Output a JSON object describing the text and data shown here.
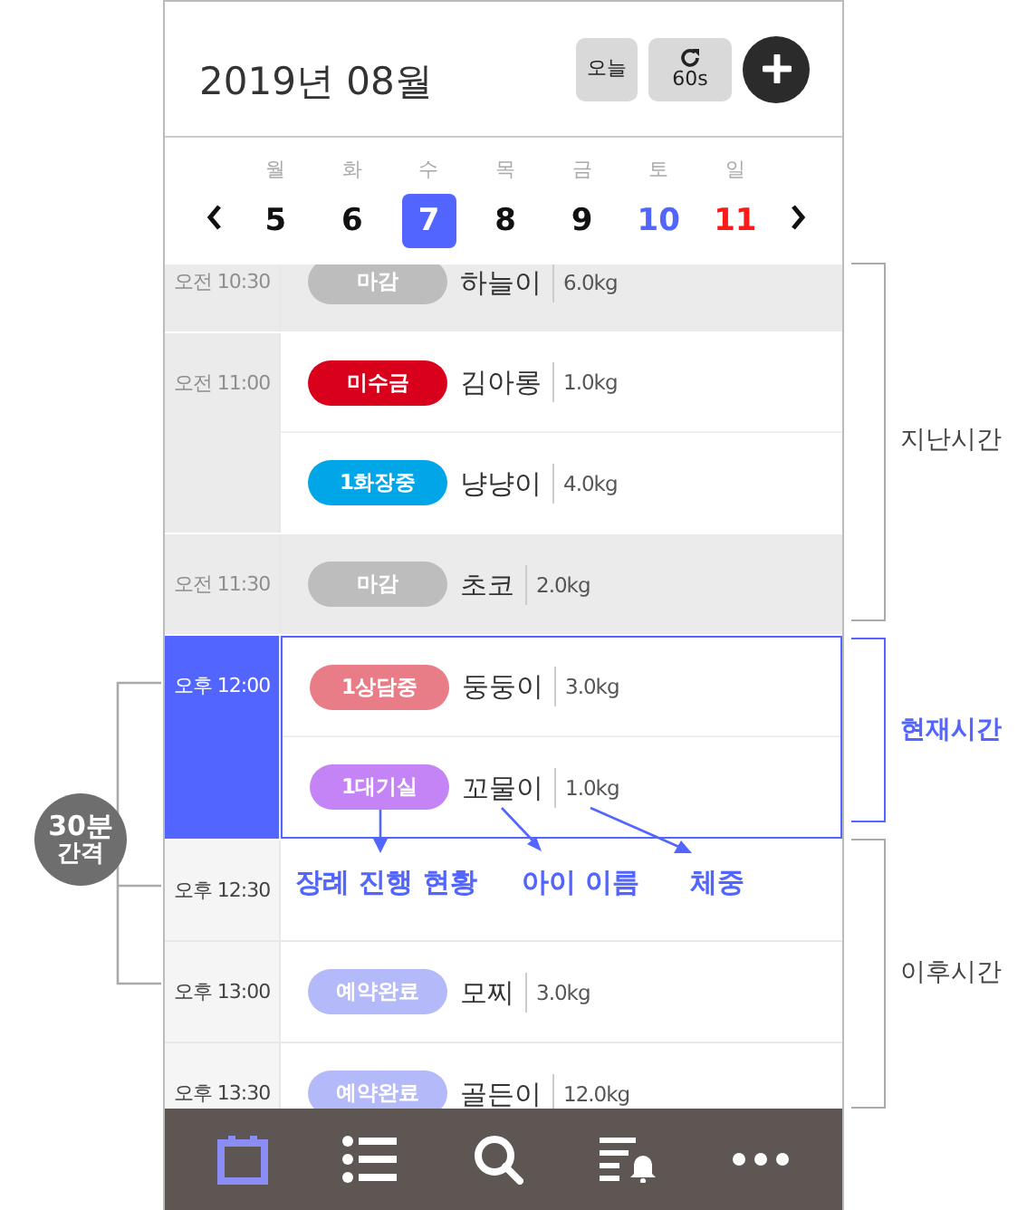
{
  "header": {
    "title": "2019년 08월",
    "today_button": "오늘",
    "refresh_button": "60s"
  },
  "week": [
    {
      "weekday": "월",
      "date": "5",
      "kind": "weekday",
      "selected": false
    },
    {
      "weekday": "화",
      "date": "6",
      "kind": "weekday",
      "selected": false
    },
    {
      "weekday": "수",
      "date": "7",
      "kind": "weekday",
      "selected": true
    },
    {
      "weekday": "목",
      "date": "8",
      "kind": "weekday",
      "selected": false
    },
    {
      "weekday": "금",
      "date": "9",
      "kind": "weekday",
      "selected": false
    },
    {
      "weekday": "토",
      "date": "10",
      "kind": "saturday",
      "selected": false
    },
    {
      "weekday": "일",
      "date": "11",
      "kind": "sunday",
      "selected": false
    }
  ],
  "timeline": [
    {
      "time": "오전 10:30",
      "kind": "past",
      "entries": [
        {
          "status": "마감",
          "color": "#bdbdbd",
          "name": "하늘이",
          "weight": "6.0kg",
          "faded": true
        }
      ]
    },
    {
      "time": "오전 11:00",
      "kind": "past",
      "entries": [
        {
          "status": "미수금",
          "color": "#d9001b",
          "name": "김아롱",
          "weight": "1.0kg",
          "faded": false
        },
        {
          "status": "1화장중",
          "color": "#00a6e8",
          "name": "냥냥이",
          "weight": "4.0kg",
          "faded": false
        }
      ]
    },
    {
      "time": "오전 11:30",
      "kind": "past",
      "entries": [
        {
          "status": "마감",
          "color": "#bdbdbd",
          "name": "초코",
          "weight": "2.0kg",
          "faded": true
        }
      ]
    },
    {
      "time": "오후 12:00",
      "kind": "current",
      "entries": [
        {
          "status": "1상담중",
          "color": "#e87d88",
          "name": "둥둥이",
          "weight": "3.0kg",
          "faded": false
        },
        {
          "status": "1대기실",
          "color": "#c484f5",
          "name": "꼬물이",
          "weight": "1.0kg",
          "faded": false
        }
      ]
    },
    {
      "time": "오후 12:30",
      "kind": "future"
    },
    {
      "time": "오후 13:00",
      "kind": "future",
      "entries": [
        {
          "status": "예약완료",
          "color": "#b4b9fa",
          "name": "모찌",
          "weight": "3.0kg",
          "faded": false
        }
      ]
    },
    {
      "time": "오후 13:30",
      "kind": "future",
      "entries": [
        {
          "status": "예약완료",
          "color": "#b4b9fa",
          "name": "골든이",
          "weight": "12.0kg",
          "faded": false
        }
      ]
    }
  ],
  "nav": [
    {
      "kind": "calendar",
      "selected": true
    },
    {
      "kind": "list",
      "selected": false
    },
    {
      "kind": "search",
      "selected": false
    },
    {
      "kind": "alarm-list",
      "selected": false
    },
    {
      "kind": "more",
      "selected": false
    }
  ],
  "annotations": {
    "past_label": "지난시간",
    "current_label": "현재시간",
    "future_label": "이후시간",
    "interval_lines": [
      "30분",
      "간격"
    ],
    "callouts": [
      "장례 진행 현황",
      "아이 이름",
      "체중"
    ]
  }
}
